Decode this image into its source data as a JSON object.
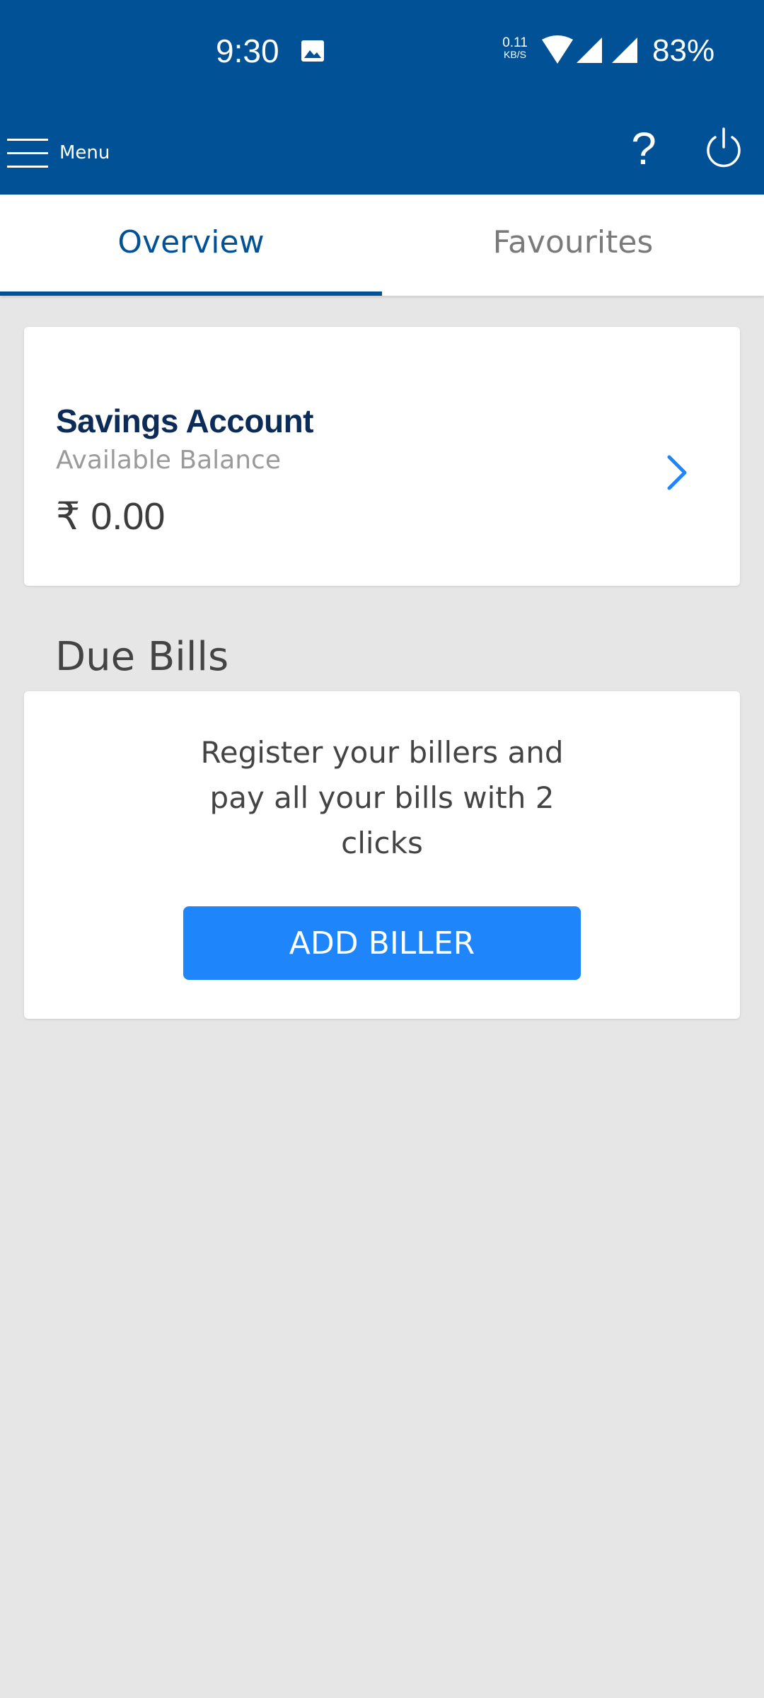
{
  "status_bar": {
    "time": "9:30",
    "net_speed_value": "0.11",
    "net_speed_unit": "KB/S",
    "battery": "83%",
    "icons": [
      "gallery-icon",
      "wifi-icon",
      "signal-icon",
      "signal-icon"
    ]
  },
  "app_bar": {
    "menu_label": "Menu",
    "help_label": "?",
    "icons": [
      "hamburger-menu-icon",
      "power-icon"
    ]
  },
  "tabs": [
    {
      "label": "Overview",
      "active": true
    },
    {
      "label": "Favourites",
      "active": false
    }
  ],
  "account": {
    "title": "Savings Account",
    "subtitle": "Available Balance",
    "balance": "₹ 0.00",
    "chevron_icon": "chevron-right-icon"
  },
  "due_bills": {
    "title": "Due Bills",
    "message": "Register your billers and pay all your bills with 2 clicks",
    "button_label": "ADD BILLER"
  },
  "colors": {
    "primary": "#005195",
    "accent": "#1f85fb",
    "background": "#e6e6e6",
    "title_dark": "#0d2b57"
  }
}
